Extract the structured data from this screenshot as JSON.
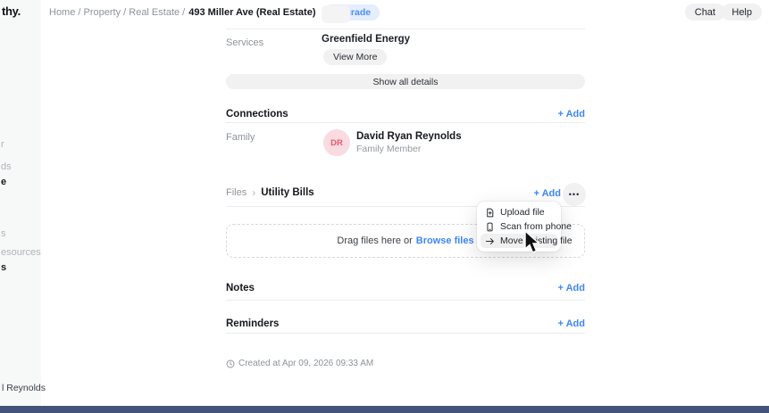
{
  "sidebar": {
    "logo_fragment": "thy.",
    "fragments": [
      {
        "text": "r"
      },
      {
        "text": "ds"
      },
      {
        "text": "e"
      },
      {
        "text": "s"
      },
      {
        "text": "esources"
      },
      {
        "text": "s"
      }
    ],
    "user_fragment": "l Reynolds"
  },
  "header": {
    "breadcrumb_path": "Home / Property / Real Estate /",
    "breadcrumb_current": "493 Miller Ave (Real Estate)",
    "upgrade_label": "Upgrade",
    "chat_label": "Chat",
    "help_label": "Help"
  },
  "services": {
    "label": "Services",
    "value": "Greenfield Energy",
    "view_more_label": "View More"
  },
  "show_all_label": "Show all details",
  "connections": {
    "title": "Connections",
    "add_label": "+ Add",
    "family_label": "Family",
    "member": {
      "initials": "DR",
      "name": "David Ryan Reynolds",
      "role": "Family Member"
    }
  },
  "files": {
    "label": "Files",
    "chevron": "›",
    "folder": "Utility Bills",
    "add_label": "+ Add",
    "ellipsis": "•••",
    "dropzone_text": "Drag files here or",
    "browse_label": "Browse files"
  },
  "context_menu": {
    "items": [
      {
        "label": "Upload file",
        "icon": "file-plus-icon"
      },
      {
        "label": "Scan from phone",
        "icon": "phone-icon"
      },
      {
        "label": "Move existing file",
        "icon": "arrow-right-icon",
        "highlighted": true
      }
    ]
  },
  "notes": {
    "title": "Notes",
    "add_label": "+ Add"
  },
  "reminders": {
    "title": "Reminders",
    "add_label": "+ Add"
  },
  "footer": {
    "created_text": "Created at Apr 09, 2026 09:33 AM"
  },
  "colors": {
    "accent_blue": "#3d87f5",
    "upgrade_bg": "#e4eefc",
    "pill_gray": "#f1f1f2",
    "avatar_bg": "#f9dbe1",
    "avatar_text": "#e25c6c",
    "bottom_bar": "#44537a",
    "sidebar_bg": "#f7f8f8"
  }
}
